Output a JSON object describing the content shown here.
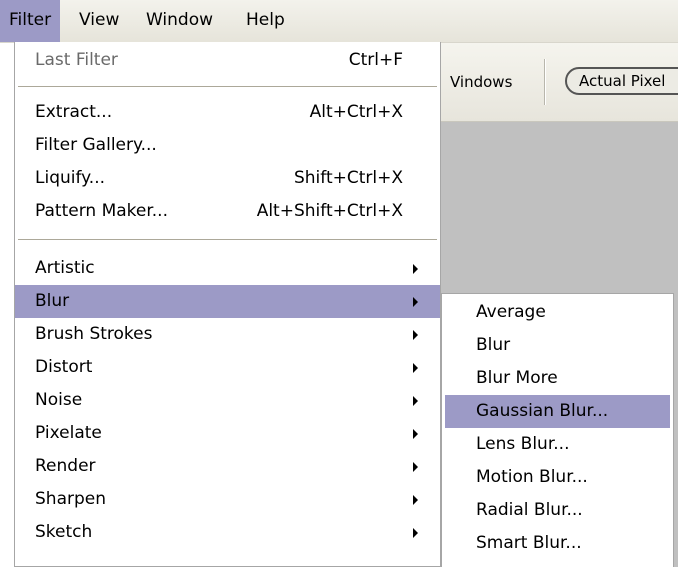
{
  "menubar": {
    "items": [
      {
        "label": "Filter",
        "active": true
      },
      {
        "label": "View",
        "active": false
      },
      {
        "label": "Window",
        "active": false
      },
      {
        "label": "Help",
        "active": false
      }
    ]
  },
  "toolbar": {
    "windows_label": "Vindows",
    "actual_pixels_label": "Actual Pixel"
  },
  "filter_menu": {
    "items": [
      {
        "label": "Last Filter",
        "shortcut": "Ctrl+F",
        "disabled": true
      },
      {
        "label": "Extract...",
        "shortcut": "Alt+Ctrl+X"
      },
      {
        "label": "Filter Gallery...",
        "shortcut": ""
      },
      {
        "label": "Liquify...",
        "shortcut": "Shift+Ctrl+X"
      },
      {
        "label": "Pattern Maker...",
        "shortcut": "Alt+Shift+Ctrl+X"
      },
      {
        "label": "Artistic",
        "submenu": true
      },
      {
        "label": "Blur",
        "submenu": true,
        "highlighted": true
      },
      {
        "label": "Brush Strokes",
        "submenu": true
      },
      {
        "label": "Distort",
        "submenu": true
      },
      {
        "label": "Noise",
        "submenu": true
      },
      {
        "label": "Pixelate",
        "submenu": true
      },
      {
        "label": "Render",
        "submenu": true
      },
      {
        "label": "Sharpen",
        "submenu": true
      },
      {
        "label": "Sketch",
        "submenu": true
      }
    ]
  },
  "blur_submenu": {
    "items": [
      {
        "label": "Average"
      },
      {
        "label": "Blur"
      },
      {
        "label": "Blur More"
      },
      {
        "label": "Gaussian Blur...",
        "highlighted": true
      },
      {
        "label": "Lens Blur..."
      },
      {
        "label": "Motion Blur..."
      },
      {
        "label": "Radial Blur..."
      },
      {
        "label": "Smart Blur..."
      }
    ]
  },
  "colors": {
    "highlight": "#9c9ac6",
    "canvas_gray": "#c0c0c0"
  }
}
